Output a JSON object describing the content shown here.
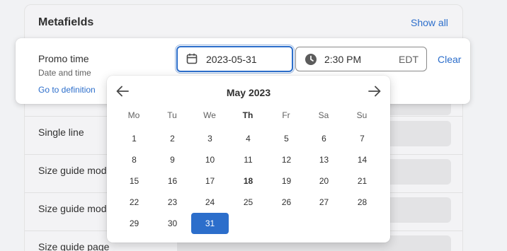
{
  "metafields": {
    "title": "Metafields",
    "show_all": "Show all"
  },
  "rows": [
    {
      "label": "Single line"
    },
    {
      "label": "Size guide mod"
    },
    {
      "label": "Size guide mod"
    },
    {
      "label": "Size guide page"
    }
  ],
  "promo": {
    "label": "Promo time",
    "sublabel": "Date and time",
    "link": "Go to definition",
    "date_value": "2023-05-31",
    "time_value": "2:30 PM",
    "timezone": "EDT",
    "clear": "Clear"
  },
  "picker": {
    "month": "May 2023",
    "weekdays": [
      "Mo",
      "Tu",
      "We",
      "Th",
      "Fr",
      "Sa",
      "Su"
    ],
    "today_weekday": "Th",
    "weeks": [
      [
        "1",
        "2",
        "3",
        "4",
        "5",
        "6",
        "7"
      ],
      [
        "8",
        "9",
        "10",
        "11",
        "12",
        "13",
        "14"
      ],
      [
        "15",
        "16",
        "17",
        "18",
        "19",
        "20",
        "21"
      ],
      [
        "22",
        "23",
        "24",
        "25",
        "26",
        "27",
        "28"
      ],
      [
        "29",
        "30",
        "31",
        "",
        "",
        "",
        ""
      ]
    ],
    "today": "18",
    "selected": "31"
  },
  "icons": {
    "calendar": "calendar-icon",
    "clock": "clock-icon",
    "prev": "arrow-left-icon",
    "next": "arrow-right-icon"
  },
  "colors": {
    "accent": "#2c6ecb"
  }
}
